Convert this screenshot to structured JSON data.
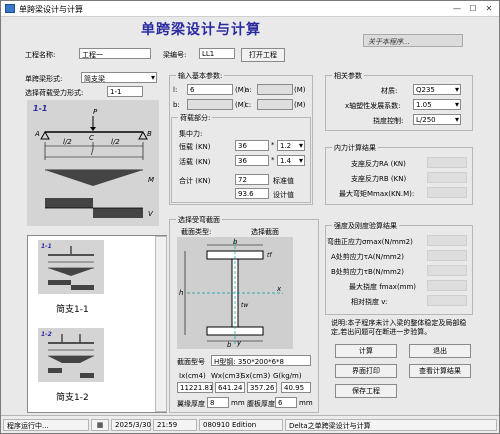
{
  "window": {
    "title": "单跨梁设计与计算"
  },
  "header": {
    "title": "单跨梁设计与计算",
    "about": "关于本程序..."
  },
  "project": {
    "name_label": "工程名称:",
    "name_value": "工程一",
    "beam_no_label": "梁编号:",
    "beam_no_value": "LL1",
    "open_button": "打开工程"
  },
  "left": {
    "form_label": "单跨梁形式:",
    "form_value": "简支梁",
    "load_label": "选择荷载受力形式:",
    "load_value": "1-1",
    "fig_title": "1-1",
    "fig_labels": {
      "P": "P",
      "A": "A",
      "B": "B",
      "C": "C",
      "half1": "l/2",
      "half2": "l/2",
      "l": "l",
      "M": "M",
      "V": "V"
    },
    "list": [
      {
        "tag": "1-1",
        "caption": "简支1-1"
      },
      {
        "tag": "1-2",
        "caption": "简支1-2"
      }
    ]
  },
  "basic": {
    "title": "输入基本参数:",
    "l_label": "l:",
    "l_value": "6",
    "l_unit": "(M)",
    "a_label": "a:",
    "a_unit": "(M)",
    "b_label": "b:",
    "b_unit": "(M)",
    "c_label": "c:",
    "c_unit": "(M)",
    "load_title": "荷载部分:",
    "conc_title": "集中力:",
    "dead_label": "恒载 (KN)",
    "dead_value": "36",
    "dead_factor": "1.2",
    "live_label": "活载 (KN)",
    "live_value": "36",
    "live_factor": "1.4",
    "total_label": "合计 (KN)",
    "std_value": "72",
    "std_label": "标准值",
    "design_value": "93.6",
    "design_label": "设计值",
    "star1": "*",
    "star2": "*"
  },
  "params": {
    "title": "相关参数",
    "material_label": "材质:",
    "material_value": "Q235",
    "gamma_label": "x轴塑性发展系数:",
    "gamma_value": "1.05",
    "defl_label": "挠度控制:",
    "defl_value": "L/250"
  },
  "internal": {
    "title": "内力计算结果",
    "ra_label": "支座反力RA (KN)",
    "rb_label": "支座反力RB (KN)",
    "mmax_label": "最大弯矩Mmax(KN.M):"
  },
  "section": {
    "title": "选择受弯截面",
    "type_label": "截面类型:",
    "pick_button": "选择截面",
    "dims": {
      "b": "b",
      "h": "h",
      "tf": "tf",
      "tw": "tw",
      "x": "x",
      "y": "y"
    },
    "model_label": "截面型号",
    "model_value": "H型钢: 350*200*6*8",
    "prop_headers": [
      "Ix(cm4)",
      "Wx(cm3)",
      "Sx(cm3)",
      "G(kg/m)"
    ],
    "prop_values": [
      "11221.81",
      "641.24",
      "357.26",
      "40.95"
    ],
    "flange_label": "翼缘厚度",
    "flange_value": "8",
    "flange_unit": "mm",
    "web_label": "腹板厚度",
    "web_value": "6",
    "web_unit": "mm"
  },
  "check": {
    "title": "强度及刚度验算结果",
    "items": [
      "弯曲正应力σmax(N/mm2)",
      "A处剪应力τA(N/mm2)",
      "B处剪应力τB(N/mm2)",
      "最大挠度 fmax(mm)",
      "相对挠度      v:"
    ]
  },
  "note": "说明:本子程序未计入梁的整体稳定及局部稳定,若出问题可在断进一步验算。",
  "buttons": {
    "calc": "计算",
    "exit": "退出",
    "print": "界面打印",
    "view": "查看计算结果",
    "save": "保存工程"
  },
  "status": {
    "state": "程序运行中...",
    "date": "2025/3/30",
    "time": "21:59",
    "edition": "080910 Edition",
    "app": "Delta之单跨梁设计与计算"
  }
}
